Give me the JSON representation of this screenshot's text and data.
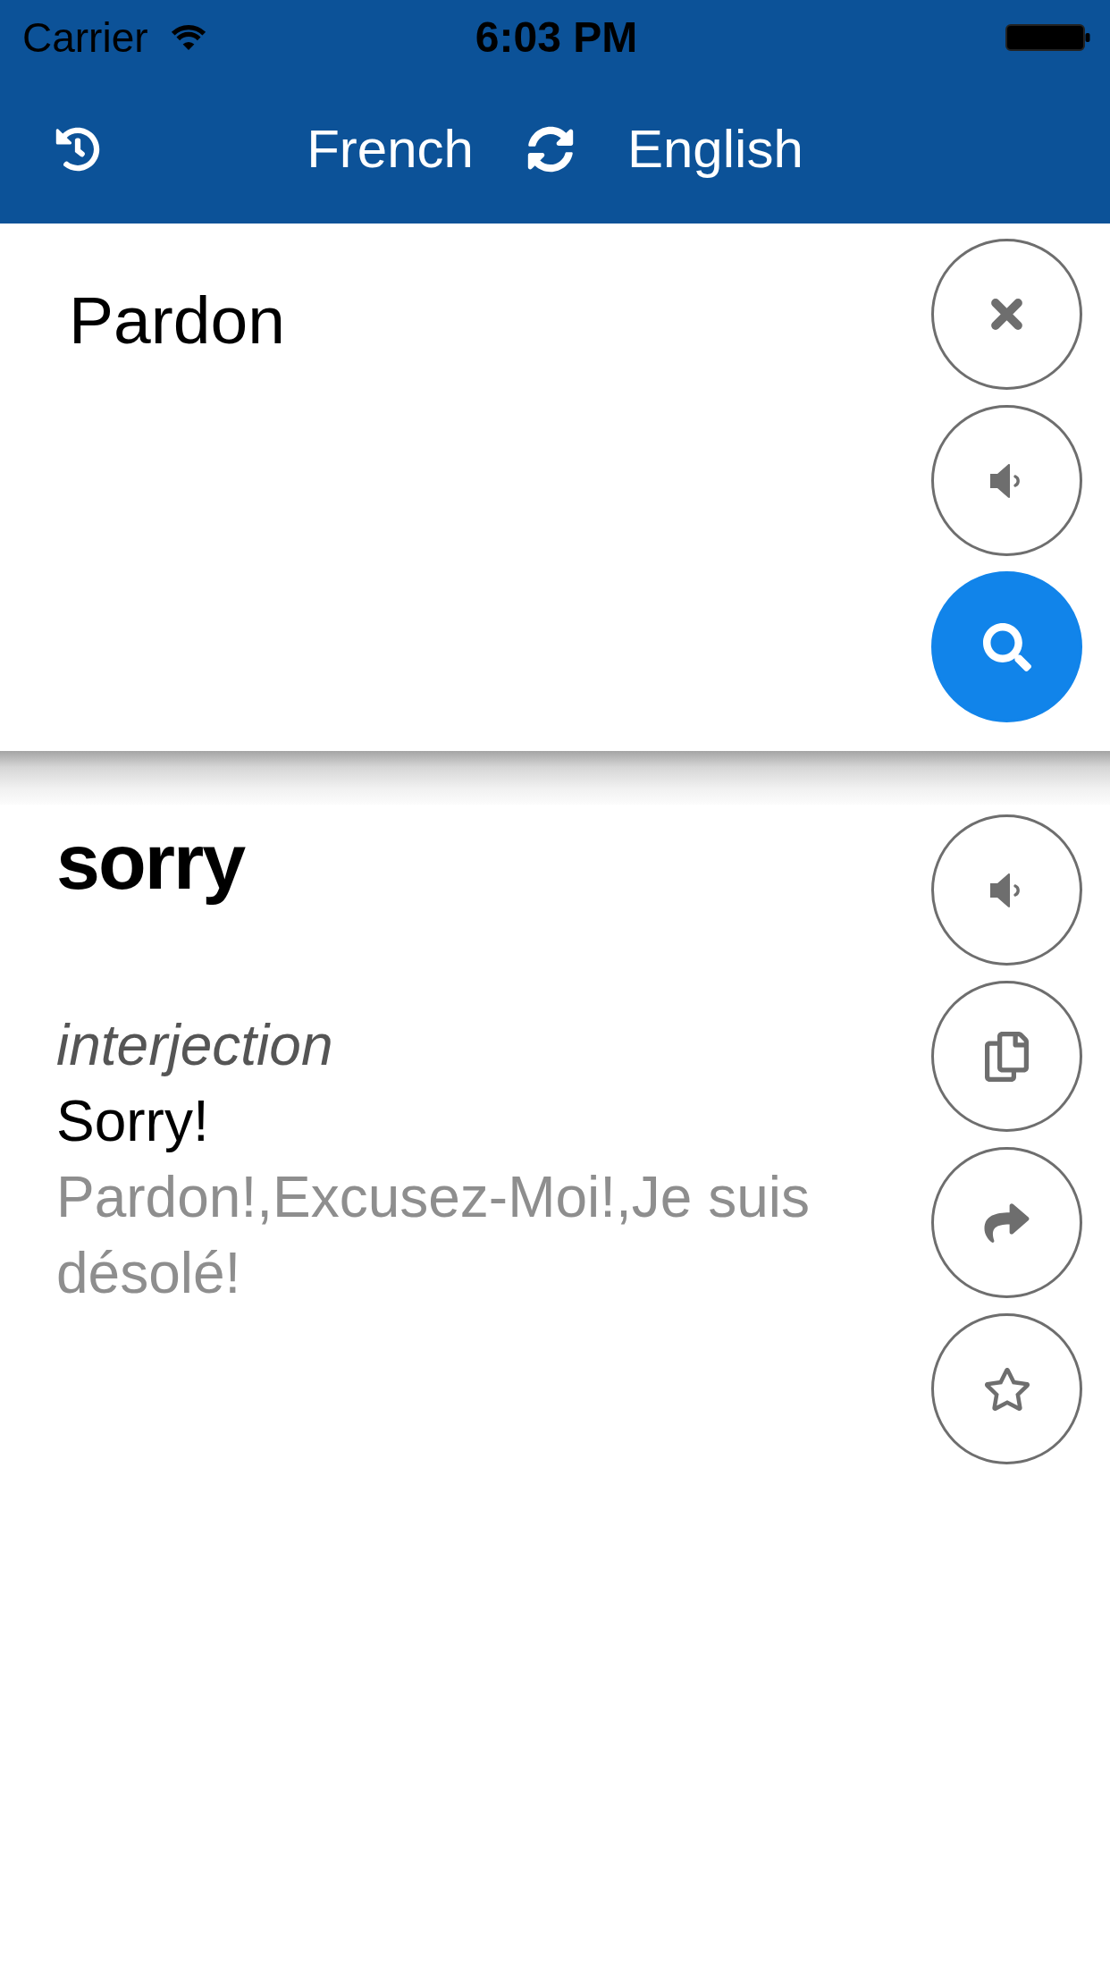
{
  "status_bar": {
    "carrier": "Carrier",
    "time": "6:03 PM"
  },
  "header": {
    "source_language": "French",
    "target_language": "English"
  },
  "input": {
    "value": "Pardon",
    "buttons": [
      {
        "kind": "clear"
      },
      {
        "kind": "speak"
      },
      {
        "kind": "search"
      }
    ]
  },
  "result": {
    "word": "sorry",
    "part_of_speech": "interjection",
    "translation": "Sorry!",
    "synonyms": "Pardon!,Excusez-Moi!,Je suis désolé!",
    "buttons": [
      {
        "kind": "speak"
      },
      {
        "kind": "copy"
      },
      {
        "kind": "share"
      },
      {
        "kind": "favorite"
      }
    ]
  }
}
